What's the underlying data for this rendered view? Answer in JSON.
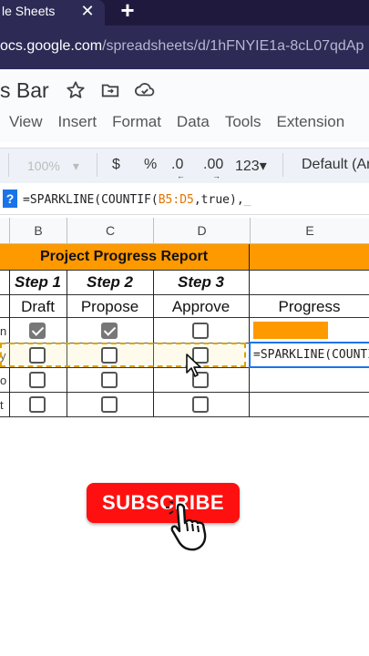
{
  "browser": {
    "tab_title": "le Sheets",
    "tab_close": "✕",
    "new_tab": "+",
    "url_host": "ocs.google.com",
    "url_path": "/spreadsheets/d/1hFNYIE1a-8cL07qdAp"
  },
  "doc": {
    "title": "s Bar",
    "icons": [
      "star-icon",
      "move-to-folder-icon",
      "cloud-saved-icon"
    ],
    "menu": [
      "View",
      "Insert",
      "Format",
      "Data",
      "Tools",
      "Extension"
    ]
  },
  "toolbar": {
    "zoom": "100%",
    "currency": "$",
    "percent": "%",
    "decrease_decimal": ".0",
    "increase_decimal": ".00",
    "number_format": "123",
    "font": "Default (Ar"
  },
  "formula_bar": {
    "help_icon": "?",
    "prefix": "=SPARKLINE(COUNTIF(",
    "range": "B5:D5",
    "suffix": ",true),",
    "cursor": "_"
  },
  "grid": {
    "columns": [
      "B",
      "C",
      "D",
      "E"
    ],
    "banner": "Project Progress Report",
    "steps": [
      "Step 1",
      "Step 2",
      "Step 3"
    ],
    "stages": [
      "Draft",
      "Propose",
      "Approve",
      "Progress"
    ],
    "row_stubs": [
      "n",
      "y",
      "o",
      "t"
    ],
    "rows": [
      {
        "checks": [
          true,
          true,
          false
        ],
        "progress": 1
      },
      {
        "checks": [
          false,
          false,
          false
        ],
        "progress": 0
      },
      {
        "checks": [
          false,
          false,
          false
        ],
        "progress": 0
      },
      {
        "checks": [
          false,
          false,
          false
        ],
        "progress": 0
      }
    ],
    "edit_cell_text": "=SPARKLINE(COUNTIF(",
    "accent": "#ff9900"
  },
  "overlay": {
    "subscribe_label": "SUBSCRIBE",
    "subscribe_color": "#ff1010"
  }
}
